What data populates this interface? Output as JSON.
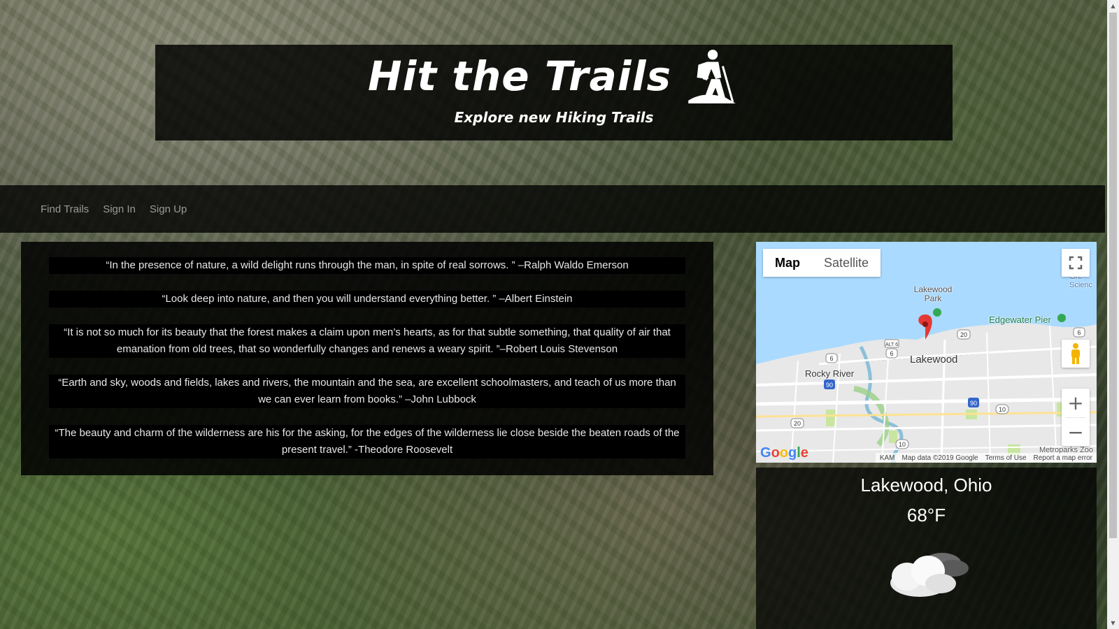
{
  "header": {
    "title": "Hit the Trails",
    "subtitle": "Explore new Hiking Trails",
    "icon": "hiker-icon"
  },
  "nav": {
    "items": [
      {
        "label": "Find Trails"
      },
      {
        "label": "Sign In"
      },
      {
        "label": "Sign Up"
      }
    ]
  },
  "quotes": [
    "“In the presence of nature, a wild delight runs through the man, in spite of real sorrows. ” –Ralph Waldo Emerson",
    "“Look deep into nature, and then you will understand everything better. ” –Albert Einstein",
    "“It is not so much for its beauty that the forest makes a claim upon men’s hearts, as for that subtle something, that quality of air that emanation from old trees, that so wonderfully changes and renews a weary spirit. ”–Robert Louis Stevenson",
    "“Earth and sky, woods and fields, lakes and rivers, the mountain and the sea, are excellent schoolmasters, and teach of us more than we can ever learn from books.” –John Lubbock",
    "“The beauty and charm of the wilderness are his for the asking, for the edges of the wilderness lie close beside the beaten roads of the present travel.” -Theodore Roosevelt"
  ],
  "map": {
    "type_map": "Map",
    "type_satellite": "Satellite",
    "fullscreen_icon": "fullscreen-icon",
    "pegman_icon": "pegman-icon",
    "zoom_in": "+",
    "zoom_out": "−",
    "logo": "Google",
    "labels": {
      "lakewood": "Lakewood",
      "lakewood_park": "Lakewood Park",
      "edgewater": "Edgewater Pier",
      "rocky_river": "Rocky River",
      "metroparks": "Metroparks Zoo",
      "science": "Gre Scienc"
    },
    "shields": [
      "20",
      "6",
      "6",
      "ALT 6",
      "90",
      "90",
      "10",
      "20",
      "10",
      "6"
    ],
    "footer": {
      "kam": "KAM",
      "data": "Map data ©2019 Google",
      "terms": "Terms of Use",
      "report": "Report a map error"
    },
    "colors": {
      "water": "#aadaff",
      "land": "#e8e8e8",
      "park": "#c8e6a0",
      "marker": "#e53935"
    }
  },
  "weather": {
    "city": "Lakewood, Ohio",
    "temp": "68°F",
    "icon": "partly-cloudy-icon"
  }
}
